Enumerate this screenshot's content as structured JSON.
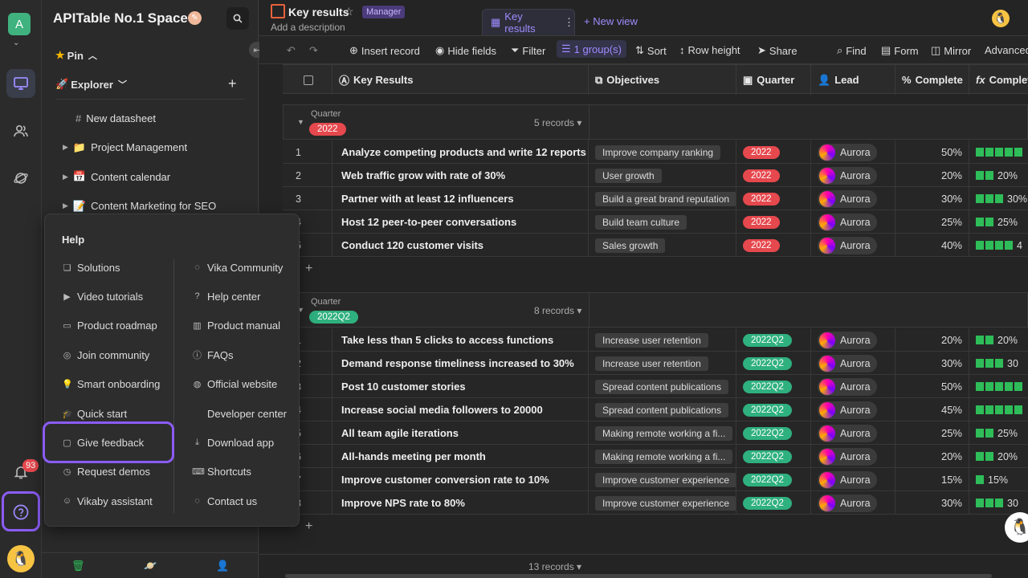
{
  "rail": {
    "workspace_initial": "A",
    "notification_count": "93"
  },
  "sidebar": {
    "space_name": "APITable No.1 Space",
    "pin_label": "Pin",
    "explorer_label": "Explorer",
    "items": [
      {
        "label": "New datasheet",
        "icon": "hash-icon"
      },
      {
        "label": "Project Management",
        "icon": "folder-icon"
      },
      {
        "label": "Content calendar",
        "icon": "calendar-icon"
      },
      {
        "label": "Content Marketing for SEO",
        "icon": "notepad-icon"
      }
    ]
  },
  "help": {
    "title": "Help",
    "left": [
      {
        "label": "Solutions",
        "icon": "layers-icon"
      },
      {
        "label": "Video tutorials",
        "icon": "video-icon"
      },
      {
        "label": "Product roadmap",
        "icon": "roadmap-icon"
      },
      {
        "label": "Join community",
        "icon": "community-icon"
      },
      {
        "label": "Smart onboarding",
        "icon": "bulb-icon"
      },
      {
        "label": "Quick start",
        "icon": "graduation-icon"
      },
      {
        "label": "Give feedback",
        "icon": "feedback-icon"
      },
      {
        "label": "Request demos",
        "icon": "clock-icon"
      },
      {
        "label": "Vikaby assistant",
        "icon": "bot-icon"
      }
    ],
    "right": [
      {
        "label": "Vika Community",
        "icon": "chat-icon"
      },
      {
        "label": "Help center",
        "icon": "question-icon"
      },
      {
        "label": "Product manual",
        "icon": "book-icon"
      },
      {
        "label": "FAQs",
        "icon": "info-icon"
      },
      {
        "label": "Official website",
        "icon": "globe-icon"
      },
      {
        "label": "Developer center",
        "icon": "code-icon"
      },
      {
        "label": "Download app",
        "icon": "download-icon"
      },
      {
        "label": "Shortcuts",
        "icon": "keyboard-icon"
      },
      {
        "label": "Contact us",
        "icon": "contact-icon"
      }
    ]
  },
  "header": {
    "title": "Key results",
    "role": "Manager",
    "description": "Add a description",
    "view_tab": "Key results",
    "new_view": "New view"
  },
  "toolbar": {
    "insert": "Insert record",
    "hide": "Hide fields",
    "filter": "Filter",
    "group": "1 group(s)",
    "sort": "Sort",
    "row_height": "Row height",
    "share": "Share",
    "find": "Find",
    "form": "Form",
    "mirror": "Mirror",
    "advanced": "Advanced"
  },
  "columns": {
    "kr": "Key Results",
    "obj": "Objectives",
    "quarter": "Quarter",
    "lead": "Lead",
    "complete": "Complete",
    "complete2": "Complete"
  },
  "groups": [
    {
      "label": "Quarter",
      "value": "2022",
      "count": "5 records",
      "color": "#e5484d",
      "rows": [
        {
          "n": "1",
          "kr": "Analyze competing products and write 12 reports",
          "obj": "Improve company ranking",
          "lead": "Aurora",
          "pct": "50%",
          "blocks": 5,
          "bar_label": ""
        },
        {
          "n": "2",
          "kr": "Web traffic grow with rate of 30%",
          "obj": "User growth",
          "lead": "Aurora",
          "pct": "20%",
          "blocks": 2,
          "bar_label": "20%"
        },
        {
          "n": "3",
          "kr": "Partner with at least 12 influencers",
          "obj": "Build a great brand reputation",
          "lead": "Aurora",
          "pct": "30%",
          "blocks": 3,
          "bar_label": "30%"
        },
        {
          "n": "4",
          "kr": "Host 12 peer-to-peer conversations",
          "obj": "Build team culture",
          "lead": "Aurora",
          "pct": "25%",
          "blocks": 2,
          "bar_label": "25%"
        },
        {
          "n": "5",
          "kr": "Conduct 120 customer visits",
          "obj": "Sales growth",
          "lead": "Aurora",
          "pct": "40%",
          "blocks": 4,
          "bar_label": "4"
        }
      ]
    },
    {
      "label": "Quarter",
      "value": "2022Q2",
      "count": "8 records",
      "color": "#2fb07f",
      "rows": [
        {
          "n": "1",
          "kr": "Take less than 5 clicks to access functions",
          "obj": "Increase user retention",
          "lead": "Aurora",
          "pct": "20%",
          "blocks": 2,
          "bar_label": "20%"
        },
        {
          "n": "2",
          "kr": "Demand response timeliness increased to 30%",
          "obj": "Increase user retention",
          "lead": "Aurora",
          "pct": "30%",
          "blocks": 3,
          "bar_label": "30"
        },
        {
          "n": "3",
          "kr": "Post 10 customer stories",
          "obj": "Spread content publications",
          "lead": "Aurora",
          "pct": "50%",
          "blocks": 5,
          "bar_label": ""
        },
        {
          "n": "4",
          "kr": "Increase social media followers to 20000",
          "obj": "Spread content publications",
          "lead": "Aurora",
          "pct": "45%",
          "blocks": 5,
          "bar_label": ""
        },
        {
          "n": "5",
          "kr": "All team agile iterations",
          "obj": "Making remote working a fi...",
          "lead": "Aurora",
          "pct": "25%",
          "blocks": 2,
          "bar_label": "25%"
        },
        {
          "n": "6",
          "kr": "All-hands meeting per month",
          "obj": "Making remote working a fi...",
          "lead": "Aurora",
          "pct": "20%",
          "blocks": 2,
          "bar_label": "20%"
        },
        {
          "n": "7",
          "kr": "Improve customer conversion rate to 10%",
          "obj": "Improve customer experience",
          "lead": "Aurora",
          "pct": "15%",
          "blocks": 1,
          "bar_label": "15%"
        },
        {
          "n": "8",
          "kr": "Improve NPS rate to 80%",
          "obj": "Improve customer experience",
          "lead": "Aurora",
          "pct": "30%",
          "blocks": 3,
          "bar_label": "30"
        }
      ]
    }
  ],
  "footer_count": "13 records"
}
